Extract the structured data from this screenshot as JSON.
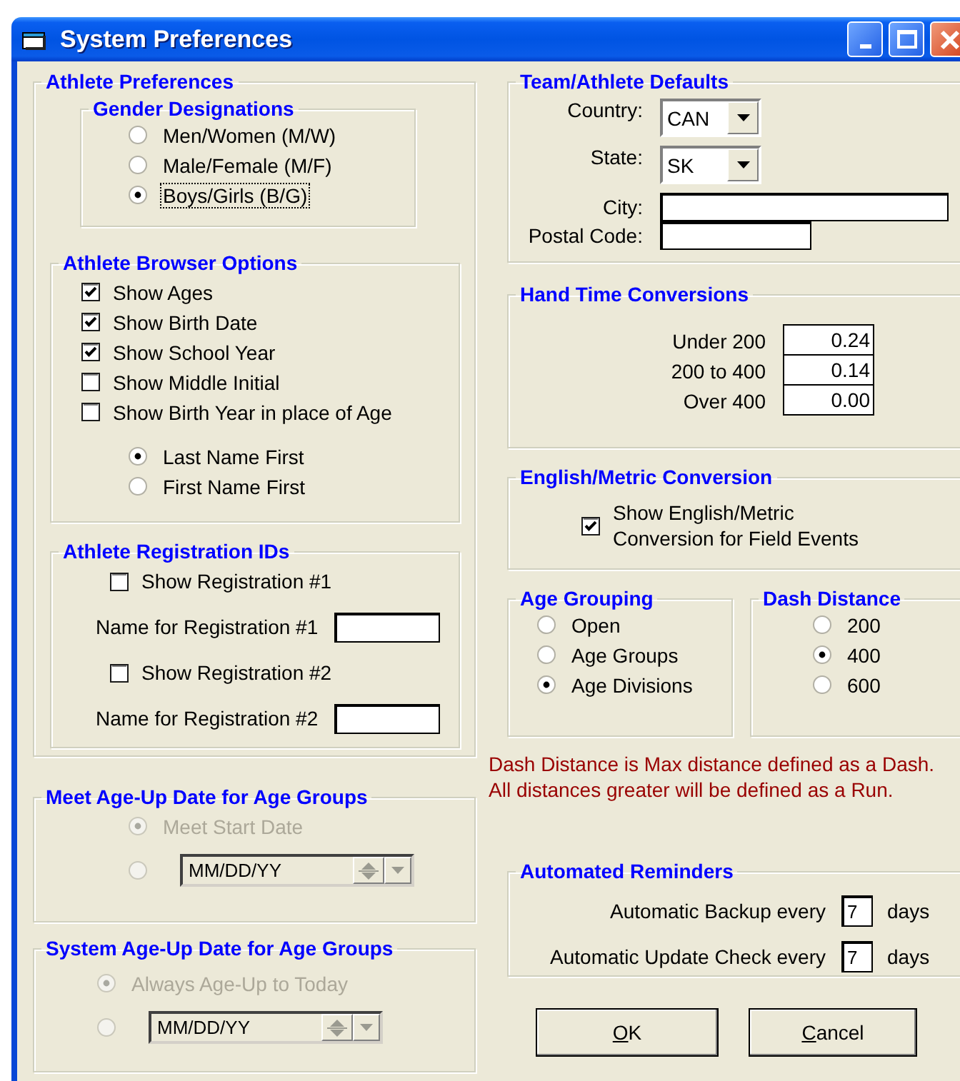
{
  "window": {
    "title": "System Preferences"
  },
  "athlete_preferences": {
    "title": "Athlete Preferences",
    "gender_designations": {
      "title": "Gender Designations",
      "options": [
        {
          "label": "Men/Women (M/W)",
          "selected": false,
          "focused": false
        },
        {
          "label": "Male/Female (M/F)",
          "selected": false,
          "focused": false
        },
        {
          "label": "Boys/Girls (B/G)",
          "selected": true,
          "focused": true
        }
      ]
    },
    "browser_options": {
      "title": "Athlete Browser Options",
      "checkboxes": [
        {
          "label": "Show Ages",
          "checked": true
        },
        {
          "label": "Show Birth Date",
          "checked": true
        },
        {
          "label": "Show School Year",
          "checked": true
        },
        {
          "label": "Show Middle Initial",
          "checked": false
        },
        {
          "label": "Show Birth Year in place of Age",
          "checked": false
        }
      ],
      "name_order": [
        {
          "label": "Last Name First",
          "selected": true
        },
        {
          "label": "First Name First",
          "selected": false
        }
      ]
    },
    "registration_ids": {
      "title": "Athlete Registration IDs",
      "items": [
        {
          "checkbox_label": "Show Registration #1",
          "checked": false,
          "name_label": "Name for Registration #1"
        },
        {
          "checkbox_label": "Show Registration #2",
          "checked": false,
          "name_label": "Name for Registration #2"
        }
      ]
    }
  },
  "meet_age_up": {
    "title": "Meet Age-Up Date for Age Groups",
    "options": [
      {
        "kind": "label",
        "label": "Meet Start Date",
        "selected": true,
        "disabled": true
      },
      {
        "kind": "date",
        "value": "MM/DD/YY",
        "selected": false,
        "disabled": true
      }
    ]
  },
  "system_age_up": {
    "title": "System Age-Up Date for Age Groups",
    "options": [
      {
        "kind": "label",
        "label": "Always Age-Up to Today",
        "selected": true,
        "disabled": true
      },
      {
        "kind": "date",
        "value": "MM/DD/YY",
        "selected": false,
        "disabled": true
      }
    ]
  },
  "team_defaults": {
    "title": "Team/Athlete Defaults",
    "fields": [
      {
        "kind": "dropdown",
        "label": "Country:",
        "value": "CAN"
      },
      {
        "kind": "dropdown",
        "label": "State:",
        "value": "SK"
      },
      {
        "kind": "long-text",
        "label": "City:"
      },
      {
        "kind": "short-text",
        "label": "Postal Code:"
      }
    ]
  },
  "hand_time_conversions": {
    "title": "Hand Time Conversions",
    "rows": [
      {
        "label": "Under 200",
        "value": "0.24"
      },
      {
        "label": "200 to 400",
        "value": "0.14"
      },
      {
        "label": "Over 400",
        "value": "0.00"
      }
    ]
  },
  "english_metric_conversion": {
    "title": "English/Metric Conversion",
    "checkbox": {
      "label": "Show English/Metric Conversion for Field Events",
      "checked": true
    }
  },
  "age_grouping": {
    "title": "Age Grouping",
    "options": [
      {
        "label": "Open",
        "selected": false
      },
      {
        "label": "Age Groups",
        "selected": false
      },
      {
        "label": "Age Divisions",
        "selected": true
      }
    ]
  },
  "dash_distance": {
    "title": "Dash Distance",
    "options": [
      {
        "label": "200",
        "selected": false
      },
      {
        "label": "400",
        "selected": true
      },
      {
        "label": "600",
        "selected": false
      }
    ]
  },
  "dash_note": [
    "Dash Distance is Max distance defined as a Dash.",
    "All distances greater will be defined as a Run."
  ],
  "automated_reminders": {
    "title": "Automated Reminders",
    "rows": [
      {
        "label": "Automatic Backup every",
        "value": "7",
        "unit": "days"
      },
      {
        "label": "Automatic Update Check every",
        "value": "7",
        "unit": "days"
      }
    ]
  },
  "buttons": [
    {
      "kind": "ok",
      "label": "OK"
    },
    {
      "kind": "cancel",
      "label": "Cancel"
    }
  ]
}
